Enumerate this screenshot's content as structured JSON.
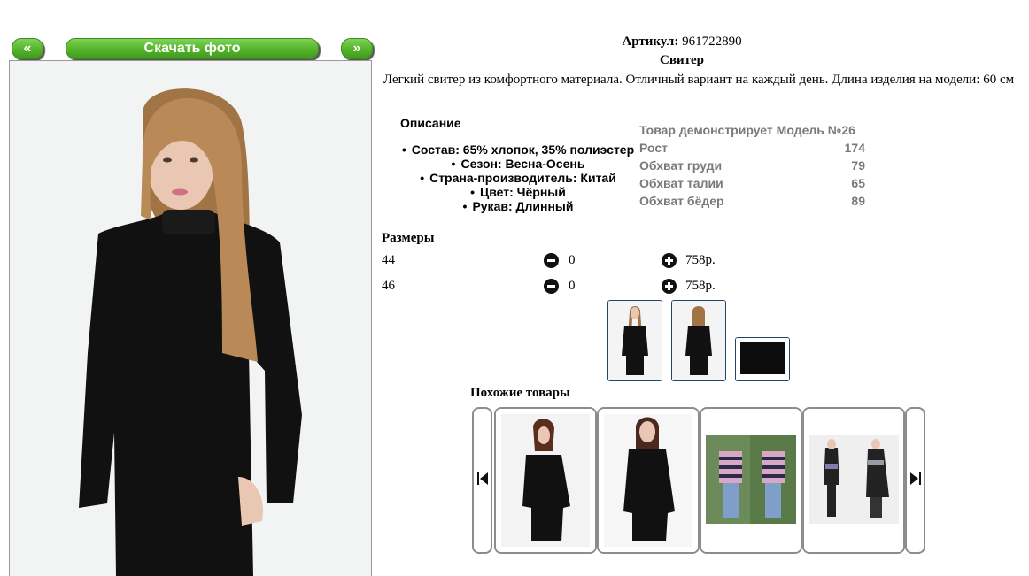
{
  "nav": {
    "prev_label": "«",
    "download_label": "Скачать фото",
    "next_label": "»"
  },
  "product": {
    "sku_label": "Артикул:",
    "sku_value": "961722890",
    "name": "Свитер",
    "description": "Легкий свитер из комфортного материала. Отличный вариант на каждый день. Длина изделия на модели: 60 см"
  },
  "details": {
    "heading": "Описание",
    "properties": [
      "Состав: 65% хлопок, 35% полиэстер",
      "Сезон: Весна-Осень",
      "Страна-производитель: Китай",
      "Цвет: Чёрный",
      "Рукав: Длинный"
    ]
  },
  "model": {
    "title": "Товар демонстрирует Модель №26",
    "rows": [
      {
        "label": "Рост",
        "value": "174"
      },
      {
        "label": "Обхват груди",
        "value": "79"
      },
      {
        "label": "Обхват талии",
        "value": "65"
      },
      {
        "label": "Обхват бёдер",
        "value": "89"
      }
    ]
  },
  "sizes": {
    "heading": "Размеры",
    "rows": [
      {
        "size": "44",
        "qty": "0",
        "price": "758р."
      },
      {
        "size": "46",
        "qty": "0",
        "price": "758р."
      }
    ]
  },
  "similar": {
    "heading": "Похожие товары"
  },
  "icons": {
    "minus": "minus-circle-icon",
    "plus": "plus-circle-icon",
    "carousel_prev": "skip-back-icon",
    "carousel_next": "skip-forward-icon"
  },
  "colors": {
    "button_green": "#56b62b",
    "thumb_border": "#23446b",
    "model_text": "#7a7a7a"
  }
}
